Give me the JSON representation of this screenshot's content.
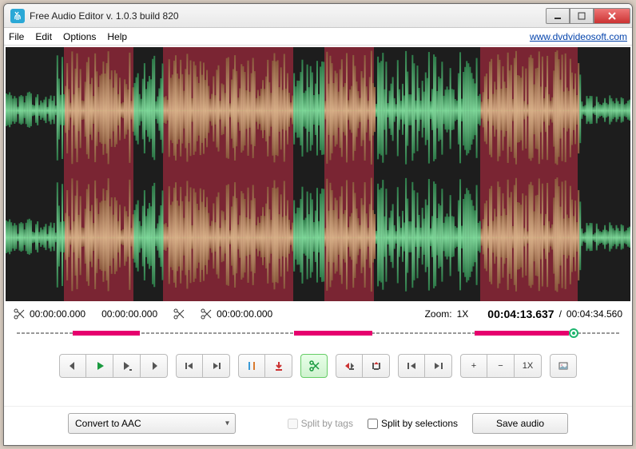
{
  "title": "Free Audio Editor v. 1.0.3 build 820",
  "menu": {
    "file": "File",
    "edit": "Edit",
    "options": "Options",
    "help": "Help"
  },
  "link": "www.dvdvideosoft.com",
  "timestamps": {
    "sel_start": "00:00:00.000",
    "sel_end": "00:00:00.000",
    "cut_pos": "00:00:00.000",
    "zoom_label": "Zoom:",
    "zoom_value": "1X",
    "current": "00:04:13.637",
    "sep": "/",
    "total": "00:04:34.560"
  },
  "regions": [
    {
      "start": 9.3,
      "end": 20.4,
      "color": "#7a2533"
    },
    {
      "start": 20.4,
      "end": 25.2,
      "color": "green"
    },
    {
      "start": 25.2,
      "end": 46.0,
      "color": "#7a2533"
    },
    {
      "start": 46.0,
      "end": 51.0,
      "color": "green"
    },
    {
      "start": 51.0,
      "end": 59.0,
      "color": "#7a2533"
    },
    {
      "start": 59.0,
      "end": 76.0,
      "color": "green"
    },
    {
      "start": 76.0,
      "end": 91.6,
      "color": "#7a2533"
    }
  ],
  "timeline_segments": [
    {
      "start": 9.3,
      "end": 20.4
    },
    {
      "start": 46.0,
      "end": 59.0
    },
    {
      "start": 76.0,
      "end": 91.6
    }
  ],
  "playhead_pct": 92.4,
  "toolbar": {
    "step_back": "step-back",
    "play": "play",
    "play_sel": "play-selection",
    "step_fwd": "step-forward",
    "skip_back": "skip-back",
    "skip_fwd": "skip-forward",
    "markers": "markers",
    "mark_down": "add-marker",
    "cut_sel": "cut-selection",
    "trim_left": "trim-left",
    "trim_right": "trim-right",
    "sel_start": "selection-start",
    "sel_end": "selection-end",
    "zoom_in": "+",
    "zoom_out": "−",
    "zoom_val": "1X",
    "picture": "picture"
  },
  "bottom": {
    "convert": "Convert to AAC",
    "split_tags": "Split by tags",
    "split_sel": "Split by selections",
    "save": "Save audio"
  }
}
